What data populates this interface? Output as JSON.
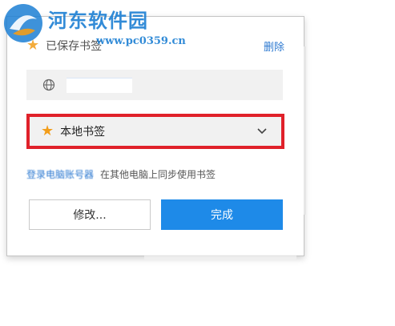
{
  "dialog": {
    "title": "已保存书签",
    "delete_label": "删除",
    "url_value": "",
    "folder": {
      "label": "本地书签"
    },
    "sync": {
      "link_label": "登录电脑账号器",
      "text": "在其他电脑上同步使用书签"
    },
    "buttons": {
      "edit_label": "修改...",
      "done_label": "完成"
    }
  },
  "watermark": {
    "name": "河东软件园",
    "url": "www.pc0359.cn"
  },
  "colors": {
    "star": "#f29d1a",
    "link": "#2e7ad1",
    "highlight_border": "#e0212a",
    "primary_button": "#1e8ae8",
    "field_background": "#f1f1f1"
  },
  "icons": {
    "title_star": "star-icon",
    "url_globe": "globe-icon",
    "folder_star": "star-icon",
    "folder_chevron": "chevron-down-icon"
  }
}
